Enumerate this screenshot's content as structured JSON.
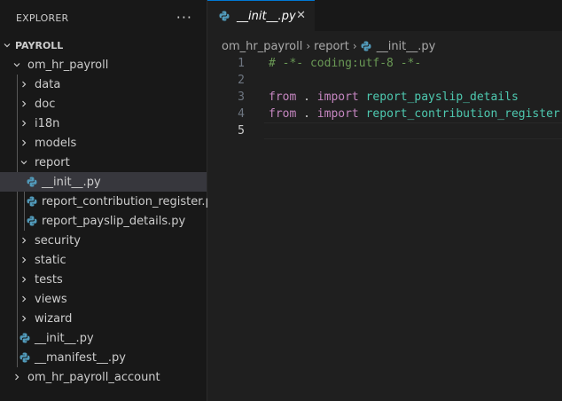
{
  "explorer": {
    "title": "EXPLORER",
    "more": "···",
    "root": "PAYROLL",
    "tree": [
      {
        "label": "om_hr_payroll",
        "kind": "folder",
        "expanded": true
      },
      {
        "label": "data",
        "kind": "folder",
        "expanded": false
      },
      {
        "label": "doc",
        "kind": "folder",
        "expanded": false
      },
      {
        "label": "i18n",
        "kind": "folder",
        "expanded": false
      },
      {
        "label": "models",
        "kind": "folder",
        "expanded": false
      },
      {
        "label": "report",
        "kind": "folder",
        "expanded": true
      },
      {
        "label": "__init__.py",
        "kind": "python-file",
        "selected": true
      },
      {
        "label": "report_contribution_register.py",
        "kind": "python-file"
      },
      {
        "label": "report_payslip_details.py",
        "kind": "python-file"
      },
      {
        "label": "security",
        "kind": "folder",
        "expanded": false
      },
      {
        "label": "static",
        "kind": "folder",
        "expanded": false
      },
      {
        "label": "tests",
        "kind": "folder",
        "expanded": false
      },
      {
        "label": "views",
        "kind": "folder",
        "expanded": false
      },
      {
        "label": "wizard",
        "kind": "folder",
        "expanded": false
      },
      {
        "label": "__init__.py",
        "kind": "python-file"
      },
      {
        "label": "__manifest__.py",
        "kind": "python-file"
      },
      {
        "label": "om_hr_payroll_account",
        "kind": "folder",
        "expanded": false
      }
    ]
  },
  "editor": {
    "tab": {
      "label": "__init__.py",
      "close": "✕",
      "icon": "python-icon"
    },
    "breadcrumbs": [
      "om_hr_payroll",
      "report",
      "__init__.py"
    ],
    "lines": [
      {
        "number": "1",
        "text": "# -*- coding:utf-8 -*-"
      },
      {
        "number": "2",
        "text": ""
      },
      {
        "number": "3",
        "text": "from . import report_payslip_details"
      },
      {
        "number": "4",
        "text": "from . import report_contribution_register"
      },
      {
        "number": "5",
        "text": ""
      }
    ],
    "current_line": "5"
  },
  "colors": {
    "background": "#1f1f1f",
    "sidebar": "#181818",
    "selection": "#37373d",
    "accent": "#0078d4",
    "python_icon": "#519aba",
    "keyword": "#c586c0",
    "module": "#4ec9b0",
    "comment": "#6a9955"
  }
}
